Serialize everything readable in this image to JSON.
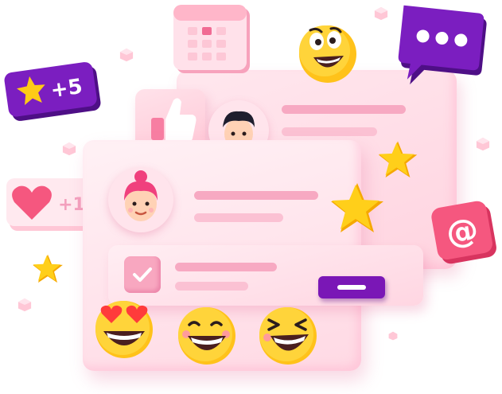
{
  "star_badge": {
    "text": "+5"
  },
  "heart_badge": {
    "text": "+1"
  },
  "at_badge": {
    "symbol": "@"
  },
  "colors": {
    "card_pink": "#ffd9e4",
    "line_pink": "#f7a9c2",
    "purple": "#7a17b6",
    "star_yellow": "#ffcb16",
    "emoji_yellow": "#ffc21a",
    "at_pink": "#f5577f"
  }
}
